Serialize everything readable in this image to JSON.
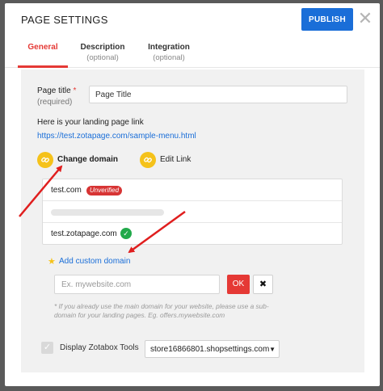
{
  "header": {
    "title": "PAGE SETTINGS",
    "publish_label": "PUBLISH",
    "close_glyph": "✕"
  },
  "tabs": [
    {
      "label": "General",
      "sub": ""
    },
    {
      "label": "Description",
      "sub": "(optional)"
    },
    {
      "label": "Integration",
      "sub": "(optional)"
    }
  ],
  "form": {
    "page_title_label": "Page title",
    "required_star": "*",
    "required_note": "(required)",
    "page_title_value": "Page Title",
    "link_heading": "Here is your landing page link",
    "link_url": "https://test.zotapage.com/sample-menu.html",
    "change_domain_label": "Change domain",
    "edit_link_label": "Edit Link"
  },
  "domains": [
    {
      "name": "test.com",
      "badge": "Unverified"
    },
    {
      "name": "",
      "badge": ""
    },
    {
      "name": "test.zotapage.com",
      "badge": ""
    }
  ],
  "custom_domain": {
    "add_label": "Add custom domain",
    "placeholder": "Ex. mywebsite.com",
    "ok_label": "OK",
    "cancel_glyph": "✖",
    "hint": "* If you already use the main domain for your website, please use a sub-domain for your landing pages. Eg. offers.mywebsite.com"
  },
  "tools": {
    "label": "Display Zotabox Tools",
    "store_value": "store16866801.shopsettings.com"
  },
  "icons": {
    "link": "link-icon",
    "check": "check-circle-icon",
    "star": "star-icon",
    "caret": "caret-down-icon"
  },
  "colors": {
    "accent_blue": "#1a6ed8",
    "accent_red": "#e53935",
    "icon_yellow": "#f5c21a",
    "verified_green": "#21a94a"
  }
}
